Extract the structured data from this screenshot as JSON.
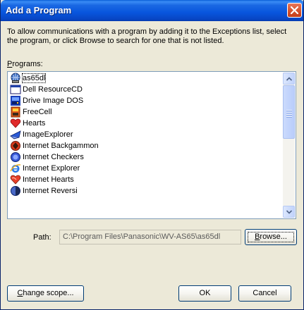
{
  "window": {
    "title": "Add a Program"
  },
  "description": "To allow communications with a program by adding it to the Exceptions list, select the program, or click Browse to search for one that is not listed.",
  "programs": {
    "label_first": "P",
    "label_rest": "rograms:",
    "items": [
      {
        "label": "as65dl",
        "icon": "network-globe-icon"
      },
      {
        "label": "Dell ResourceCD",
        "icon": "window-icon"
      },
      {
        "label": "Drive Image DOS",
        "icon": "drive-image-icon"
      },
      {
        "label": "FreeCell",
        "icon": "freecell-icon"
      },
      {
        "label": "Hearts",
        "icon": "heart-icon"
      },
      {
        "label": "ImageExplorer",
        "icon": "image-explorer-icon"
      },
      {
        "label": "Internet Backgammon",
        "icon": "backgammon-icon"
      },
      {
        "label": "Internet Checkers",
        "icon": "checkers-icon"
      },
      {
        "label": "Internet Explorer",
        "icon": "ie-icon"
      },
      {
        "label": "Internet Hearts",
        "icon": "internet-hearts-icon"
      },
      {
        "label": "Internet Reversi",
        "icon": "reversi-icon"
      }
    ]
  },
  "path": {
    "label": "Path:",
    "value": "C:\\Program Files\\Panasonic\\WV-AS65\\as65dl"
  },
  "buttons": {
    "browse_first": "B",
    "browse_rest": "rowse...",
    "change_scope_first": "C",
    "change_scope_rest": "hange scope...",
    "ok": "OK",
    "cancel": "Cancel"
  },
  "colors": {
    "titlebar": "#0855dd",
    "dialog_bg": "#ece9d8",
    "close_button": "#d8552f"
  }
}
